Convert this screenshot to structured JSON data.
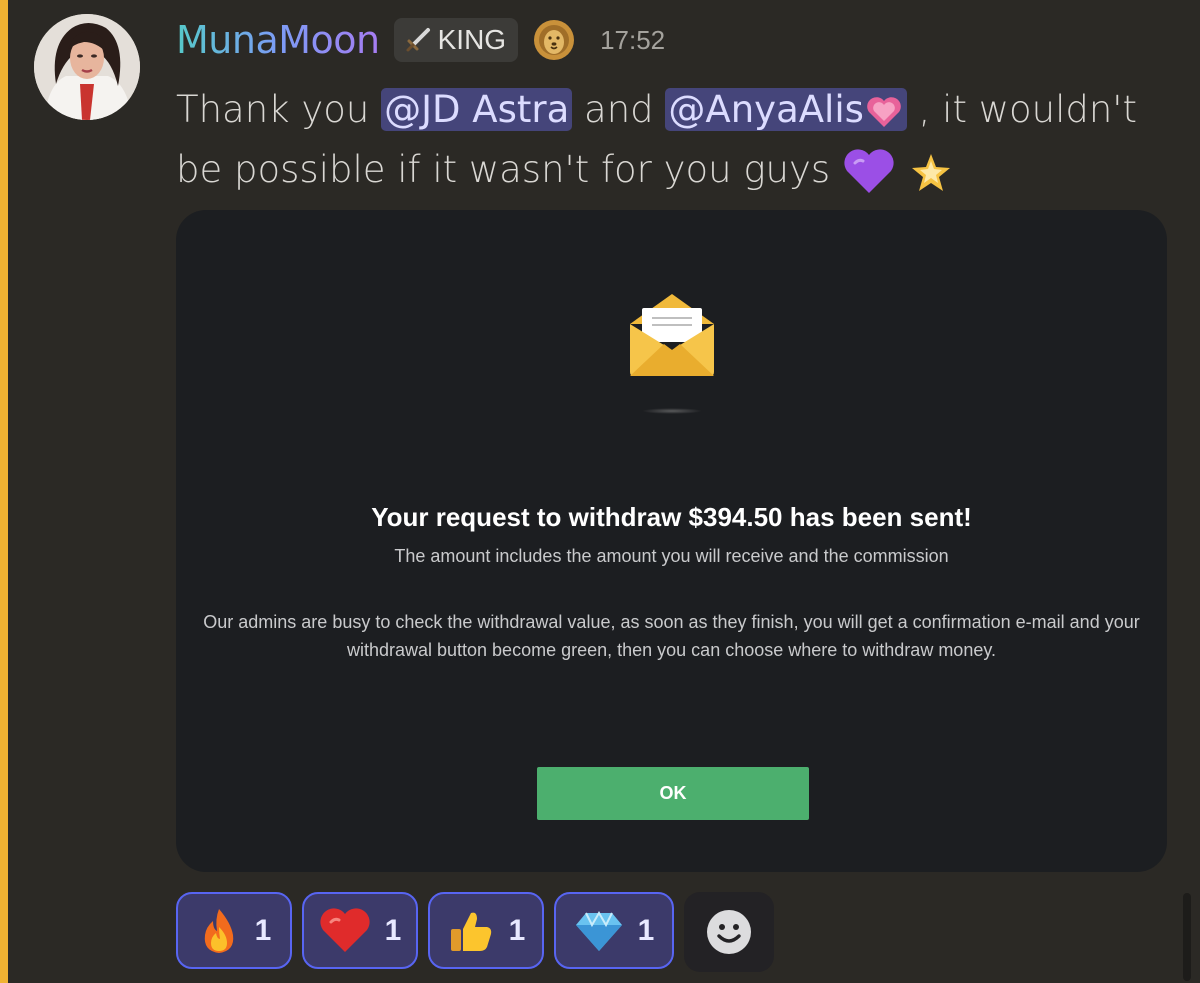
{
  "message": {
    "author": "MunaMoon",
    "role_tag": "KING",
    "role_icon": "dagger-icon",
    "badge_icon": "lion-icon",
    "timestamp": "17:52",
    "text_1": "Thank you ",
    "mention_1": "@JD Astra",
    "text_2": " and ",
    "mention_2": "@AnyaAlis",
    "mention_2_emoji": "sparkling-heart-icon",
    "text_3": " , it wouldn't be possible if it wasn't for you guys ",
    "trailing_emojis": [
      "purple-heart-icon",
      "glowing-star-icon"
    ]
  },
  "embed": {
    "icon": "envelope-icon",
    "title": "Your request to withdraw $394.50 has been sent!",
    "subtitle": "The amount includes the amount you will receive and the commission",
    "body": "Our admins are busy to check the withdrawal value, as soon as they finish, you will get a confirmation e-mail and your withdrawal button become green, then you can choose where to withdraw money.",
    "button_label": "OK",
    "button_color": "#4caf6e"
  },
  "reactions": [
    {
      "icon": "fire-icon",
      "count": "1"
    },
    {
      "icon": "red-heart-icon",
      "count": "1"
    },
    {
      "icon": "thumbs-up-icon",
      "count": "1"
    },
    {
      "icon": "gem-icon",
      "count": "1"
    }
  ],
  "add_reaction_icon": "smiley-icon",
  "colors": {
    "mention_background": "#45457a",
    "reaction_border": "#5865f2",
    "mention_stripe": "#f0b232",
    "username_gradient": [
      "#56c9c9",
      "#a77cf2"
    ]
  }
}
